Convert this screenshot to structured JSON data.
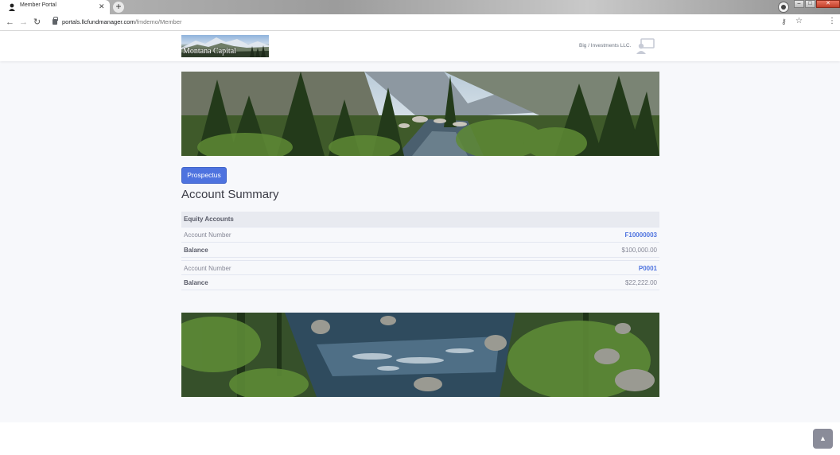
{
  "browser": {
    "tab_title": "Member Portal",
    "tab_close": "✕",
    "new_tab": "+",
    "url_host": "portals.llcfundmanager.com",
    "url_path": "/fmdemo/Member",
    "window_min": "–",
    "window_max": "□",
    "window_close": "✕"
  },
  "header": {
    "logo_text": "Montana Capital",
    "user_name": "Big / Investments LLC.",
    "user_icon": "presenter-user-icon"
  },
  "main": {
    "prospectus_label": "Prospectus",
    "title": "Account Summary",
    "section_heading": "Equity Accounts",
    "accounts": [
      {
        "account_label": "Account Number",
        "account_number": "F10000003",
        "balance_label": "Balance",
        "balance": "$100,000.00"
      },
      {
        "account_label": "Account Number",
        "account_number": "P0001",
        "balance_label": "Balance",
        "balance": "$22,222.00"
      }
    ]
  },
  "scroll_top_icon": "chevron-up-icon",
  "colors": {
    "primary": "#4e73df",
    "page_background": "#f7f8fb",
    "table_header": "#e8eaf0",
    "text_muted": "#858796"
  }
}
